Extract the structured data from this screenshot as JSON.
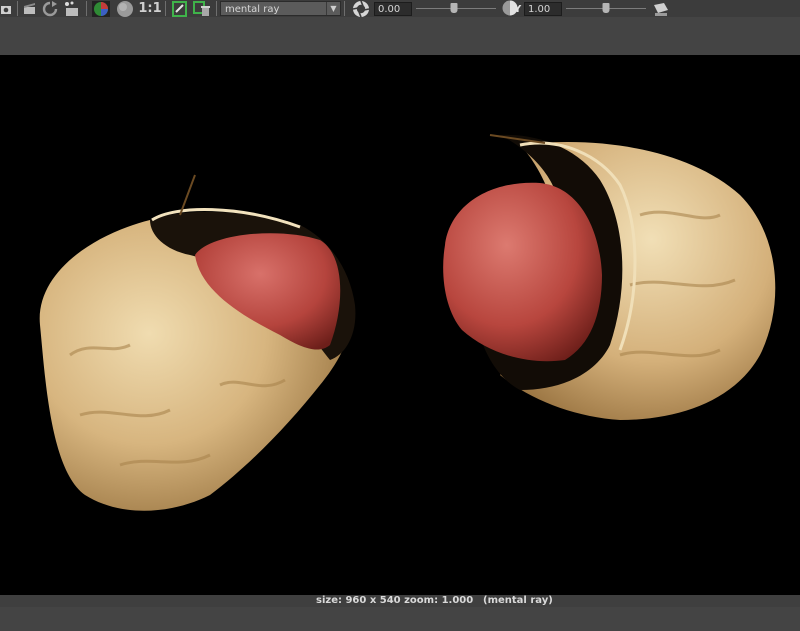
{
  "toolbar": {
    "ratio_label": "1:1",
    "renderer": {
      "selected": "mental ray"
    },
    "exposure": {
      "value": "0.00",
      "slider_level": 0.48
    },
    "gamma": {
      "label": "Y",
      "value": "1.00",
      "slider_level": 0.5
    }
  },
  "statusbar": {
    "info": "size: 960 x 540 zoom: 1.000",
    "renderer": "(mental ray)"
  },
  "colors": {
    "shell_light": "#e8cf9c",
    "shell_dark": "#9c7a45",
    "kernel": "#c24a40",
    "background": "#000000"
  }
}
